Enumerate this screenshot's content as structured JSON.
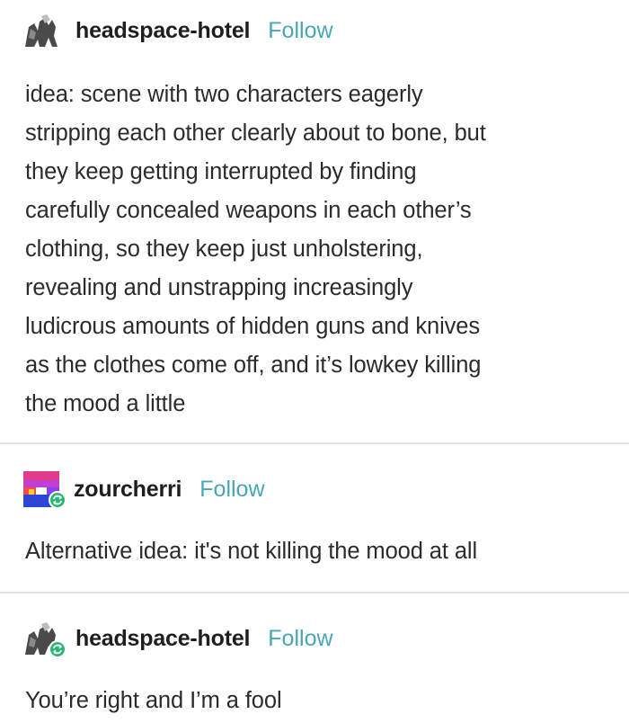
{
  "posts": [
    {
      "username": "headspace-hotel",
      "follow_label": "Follow",
      "avatar_icon": "headspace-hotel-avatar-icon",
      "reblog": false,
      "lines": [
        "idea: scene with two characters eagerly",
        "stripping each other clearly about to bone, but",
        "they keep getting interrupted by finding",
        "carefully concealed weapons in each other’s",
        "clothing, so they keep just unholstering,",
        "revealing and unstrapping increasingly",
        "ludicrous amounts of hidden guns and knives",
        "as the clothes come off, and it’s lowkey killing",
        "the mood a little"
      ]
    },
    {
      "username": "zourcherri",
      "follow_label": "Follow",
      "avatar_icon": "zourcherri-avatar-icon",
      "reblog": true,
      "lines": [
        "Alternative idea: it's not killing the mood at all"
      ]
    },
    {
      "username": "headspace-hotel",
      "follow_label": "Follow",
      "avatar_icon": "headspace-hotel-avatar-icon",
      "reblog": true,
      "lines": [
        "You’re right and I’m a fool"
      ]
    }
  ],
  "colors": {
    "follow": "#47a7b5",
    "reblog_badge": "#2bb673",
    "divider": "#e2e2e2",
    "text": "#2b2b2b"
  }
}
